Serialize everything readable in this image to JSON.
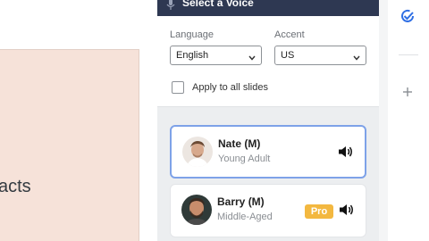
{
  "slide": {
    "text": "acts"
  },
  "voice_panel": {
    "title": "Select a Voice",
    "icons": {
      "header": "microphone-icon"
    },
    "language": {
      "label": "Language",
      "selected": "English"
    },
    "accent": {
      "label": "Accent",
      "selected": "US"
    },
    "apply_all": {
      "label": "Apply to all slides",
      "checked": false
    },
    "voices": [
      {
        "name": "Nate (M)",
        "description": "Young Adult",
        "selected": true,
        "pro": false
      },
      {
        "name": "Barry (M)",
        "description": "Middle-Aged",
        "selected": false,
        "pro": true,
        "badge": "Pro"
      }
    ]
  },
  "right_rail": {
    "icons": [
      "check-circle-icon",
      "plus-icon"
    ]
  },
  "colors": {
    "header_bg": "#2e3852",
    "selected_border": "#7ea2e8",
    "pro_badge": "#f3b840",
    "slide_bg": "#f6e2d9",
    "rail_accent": "#2f6fe4"
  }
}
